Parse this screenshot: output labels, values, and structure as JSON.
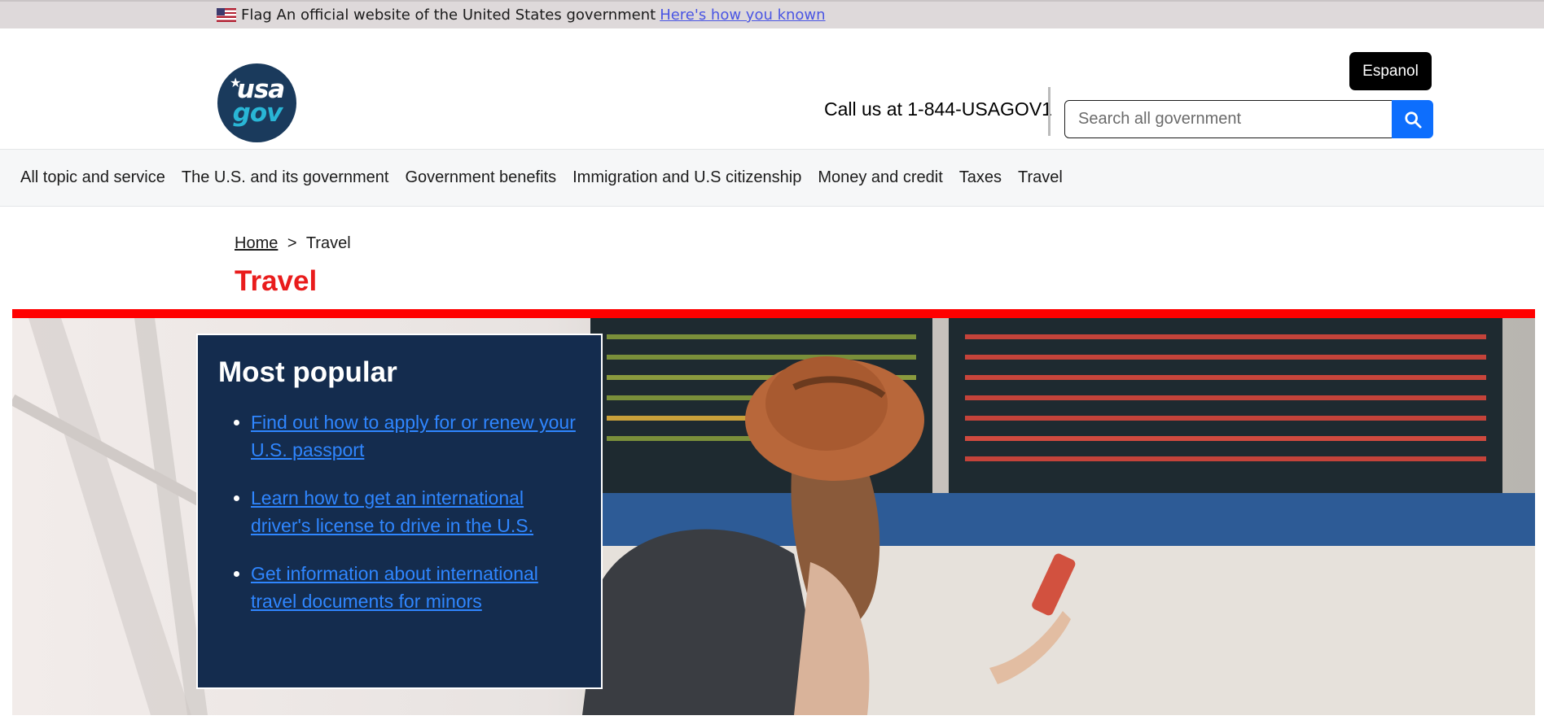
{
  "banner": {
    "flag_alt": "Flag",
    "text": "An official website of the United States government",
    "link": "Here's how you known"
  },
  "header": {
    "logo": {
      "line1": "usa",
      "line2": "gov"
    },
    "espanol_label": "Espanol",
    "call_text": "Call us at 1-844-USAGOV1",
    "search": {
      "placeholder": "Search all government",
      "value": "",
      "button_icon": "search-icon"
    }
  },
  "nav": {
    "items": [
      "All topic and service",
      "The U.S. and its government",
      "Government benefits",
      "Immigration and U.S citizenship",
      "Money and credit",
      "Taxes",
      "Travel"
    ]
  },
  "breadcrumb": {
    "home": "Home",
    "separator": ">",
    "current": "Travel"
  },
  "page": {
    "title": "Travel"
  },
  "popular": {
    "heading": "Most popular",
    "links": [
      "Find out how to apply for or renew your U.S. passport",
      "Learn how to get an international driver's license to drive in the U.S.",
      "Get information about international travel documents for minors"
    ]
  },
  "colors": {
    "title_red": "#e91c1c",
    "accent_bar": "#ff0000",
    "search_blue": "#0d6efd",
    "popular_bg": "#142c4e",
    "link_blue": "#2f86ff"
  }
}
